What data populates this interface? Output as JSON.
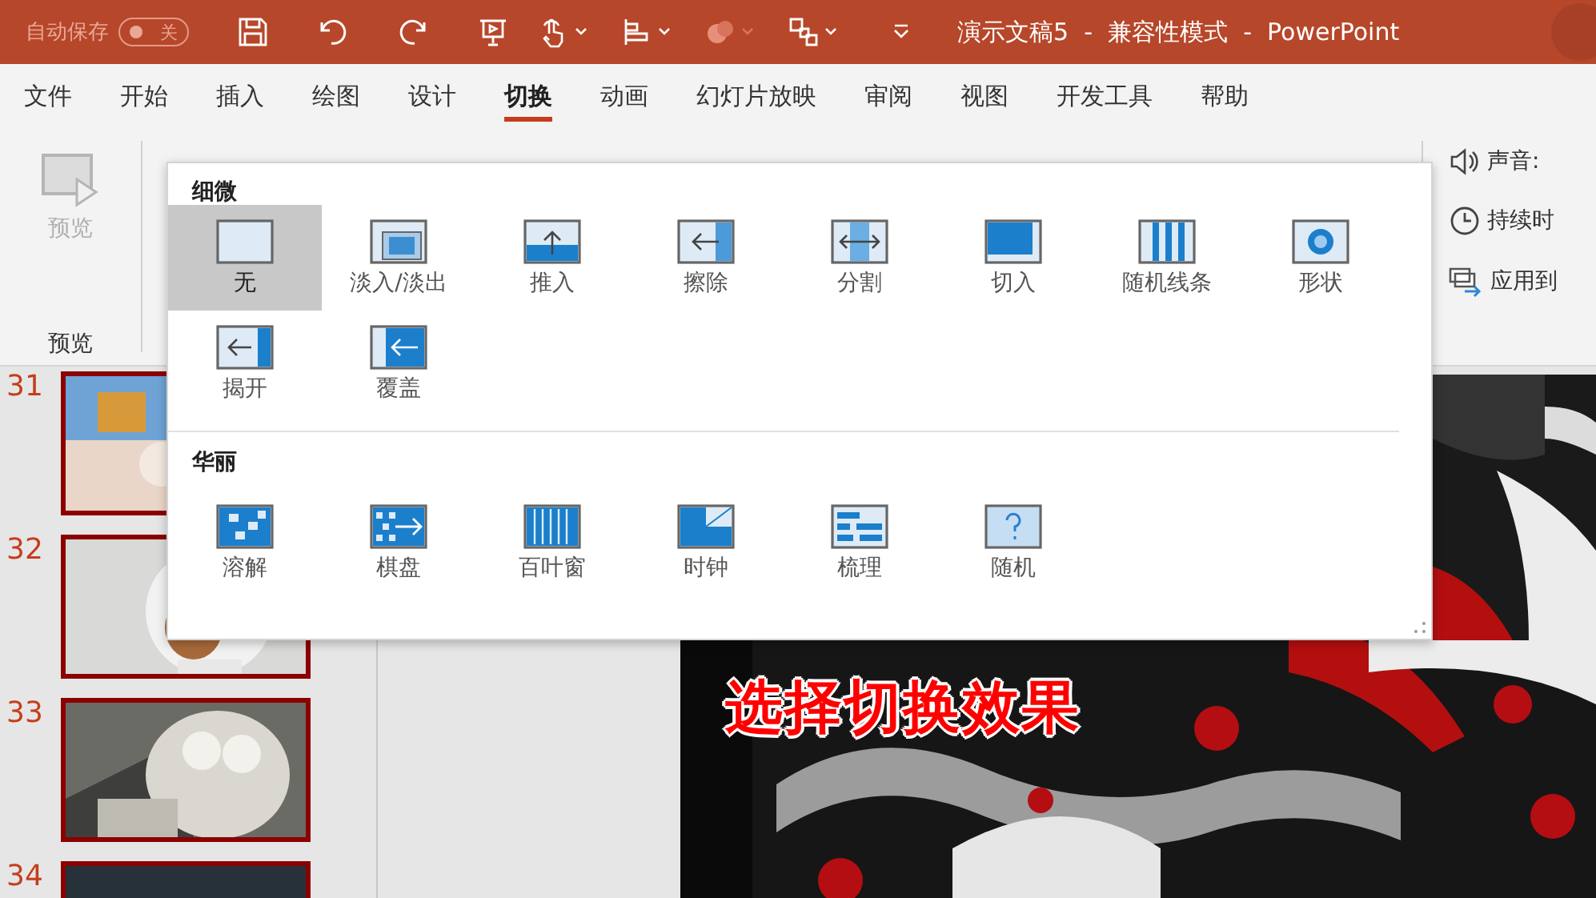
{
  "title_bar": {
    "autosave_label": "自动保存",
    "autosave": {
      "on": false,
      "label": "关"
    },
    "title": "演示文稿5  -  兼容性模式  -  PowerPoint"
  },
  "tabs": [
    {
      "label": "文件",
      "selected": false
    },
    {
      "label": "开始",
      "selected": false
    },
    {
      "label": "插入",
      "selected": false
    },
    {
      "label": "绘图",
      "selected": false
    },
    {
      "label": "设计",
      "selected": false
    },
    {
      "label": "切换",
      "selected": true
    },
    {
      "label": "动画",
      "selected": false
    },
    {
      "label": "幻灯片放映",
      "selected": false
    },
    {
      "label": "审阅",
      "selected": false
    },
    {
      "label": "视图",
      "selected": false
    },
    {
      "label": "开发工具",
      "selected": false
    },
    {
      "label": "帮助",
      "selected": false
    }
  ],
  "ribbon": {
    "preview_button": {
      "label": "预览",
      "disabled": true
    },
    "preview_group_label": "预览",
    "options": [
      {
        "kind": "sound",
        "label": "声音:"
      },
      {
        "kind": "duration",
        "label": "持续时"
      },
      {
        "kind": "apply",
        "label": "应用到"
      }
    ]
  },
  "gallery": {
    "sections": [
      {
        "title": "细微",
        "items": [
          {
            "kind": "none",
            "label": "无",
            "selected": true
          },
          {
            "kind": "fade",
            "label": "淡入/淡出",
            "selected": false
          },
          {
            "kind": "push",
            "label": "推入",
            "selected": false
          },
          {
            "kind": "wipe",
            "label": "擦除",
            "selected": false
          },
          {
            "kind": "split",
            "label": "分割",
            "selected": false
          },
          {
            "kind": "cut",
            "label": "切入",
            "selected": false
          },
          {
            "kind": "bars",
            "label": "随机线条",
            "selected": false
          },
          {
            "kind": "shape",
            "label": "形状",
            "selected": false
          },
          {
            "kind": "uncover",
            "label": "揭开",
            "selected": false
          },
          {
            "kind": "cover",
            "label": "覆盖",
            "selected": false
          }
        ]
      },
      {
        "title": "华丽",
        "items": [
          {
            "kind": "dissolve",
            "label": "溶解",
            "selected": false
          },
          {
            "kind": "checker",
            "label": "棋盘",
            "selected": false
          },
          {
            "kind": "blinds",
            "label": "百叶窗",
            "selected": false
          },
          {
            "kind": "clock",
            "label": "时钟",
            "selected": false
          },
          {
            "kind": "comb",
            "label": "梳理",
            "selected": false
          },
          {
            "kind": "random",
            "label": "随机",
            "selected": false
          }
        ]
      }
    ]
  },
  "thumbnails": [
    {
      "number": "31",
      "selected": true
    },
    {
      "number": "32",
      "selected": true
    },
    {
      "number": "33",
      "selected": true
    },
    {
      "number": "34",
      "selected": true
    }
  ],
  "slide": {
    "caption": "选择切换效果"
  }
}
